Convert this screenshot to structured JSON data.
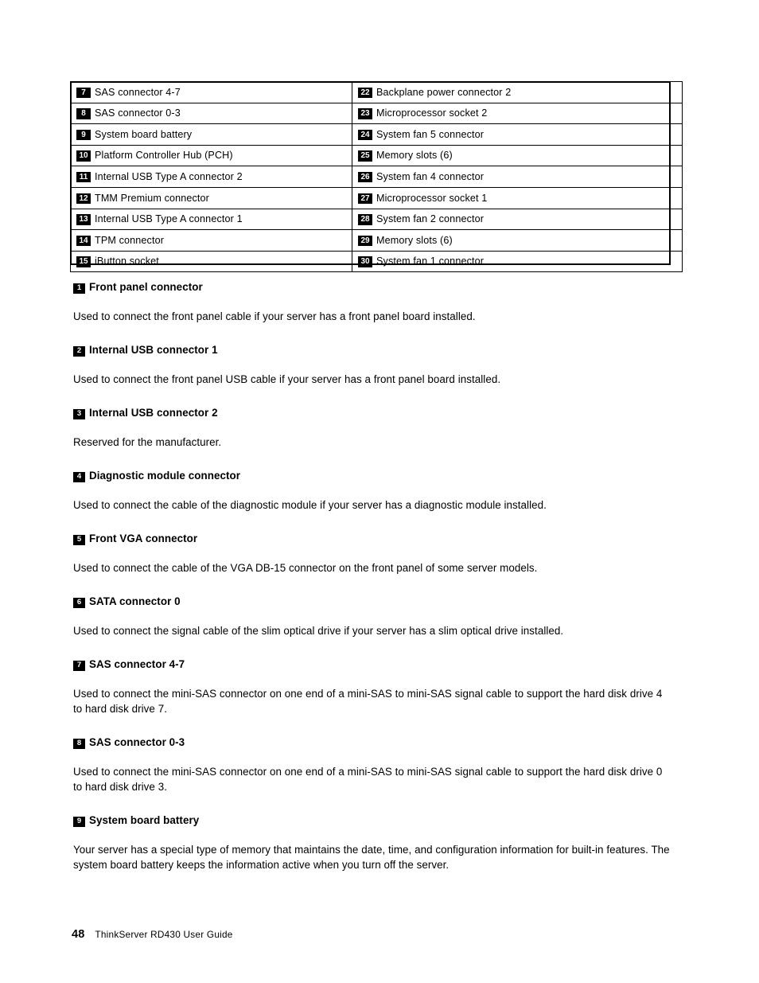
{
  "document": {
    "page_number": "48",
    "guide_title": "ThinkServer RD430 User Guide"
  },
  "legend_table": {
    "rows": [
      {
        "left_num": "7",
        "left_label": "SAS connector 4-7",
        "right_num": "22",
        "right_label": "Backplane power connector 2"
      },
      {
        "left_num": "8",
        "left_label": "SAS connector 0-3",
        "right_num": "23",
        "right_label": "Microprocessor socket 2"
      },
      {
        "left_num": "9",
        "left_label": "System board battery",
        "right_num": "24",
        "right_label": "System fan 5 connector"
      },
      {
        "left_num": "10",
        "left_label": "Platform Controller Hub (PCH)",
        "right_num": "25",
        "right_label": "Memory slots (6)"
      },
      {
        "left_num": "11",
        "left_label": "Internal USB Type A connector 2",
        "right_num": "26",
        "right_label": "System fan 4 connector"
      },
      {
        "left_num": "12",
        "left_label": "TMM Premium connector",
        "right_num": "27",
        "right_label": "Microprocessor socket 1"
      },
      {
        "left_num": "13",
        "left_label": "Internal USB Type A connector 1",
        "right_num": "28",
        "right_label": "System fan 2 connector"
      },
      {
        "left_num": "14",
        "left_label": "TPM connector",
        "right_num": "29",
        "right_label": "Memory slots (6)"
      },
      {
        "left_num": "15",
        "left_label": "iButton socket",
        "right_num": "30",
        "right_label": "System fan 1 connector"
      }
    ]
  },
  "sections": [
    {
      "num": "1",
      "heading": "Front panel connector",
      "body": "Used to connect the front panel cable if your server has a front panel board installed."
    },
    {
      "num": "2",
      "heading": "Internal USB connector 1",
      "body": "Used to connect the front panel USB cable if your server has a front panel board installed."
    },
    {
      "num": "3",
      "heading": "Internal USB connector 2",
      "body": "Reserved for the manufacturer."
    },
    {
      "num": "4",
      "heading": "Diagnostic module connector",
      "body": "Used to connect the cable of the diagnostic module if your server has a diagnostic module installed."
    },
    {
      "num": "5",
      "heading": "Front VGA connector",
      "body": "Used to connect the cable of the VGA DB-15 connector on the front panel of some server models."
    },
    {
      "num": "6",
      "heading": "SATA connector 0",
      "body": "Used to connect the signal cable of the slim optical drive if your server has a slim optical drive installed."
    },
    {
      "num": "7",
      "heading": "SAS connector 4-7",
      "body": "Used to connect the mini-SAS connector on one end of a mini-SAS to mini-SAS signal cable to support the hard disk drive 4 to hard disk drive 7."
    },
    {
      "num": "8",
      "heading": "SAS connector 0-3",
      "body": "Used to connect the mini-SAS connector on one end of a mini-SAS to mini-SAS signal cable to support the hard disk drive 0 to hard disk drive 3."
    },
    {
      "num": "9",
      "heading": "System board battery",
      "body": "Your server has a special type of memory that maintains the date, time, and configuration information for built-in features. The system board battery keeps the information active when you turn off the server."
    }
  ]
}
